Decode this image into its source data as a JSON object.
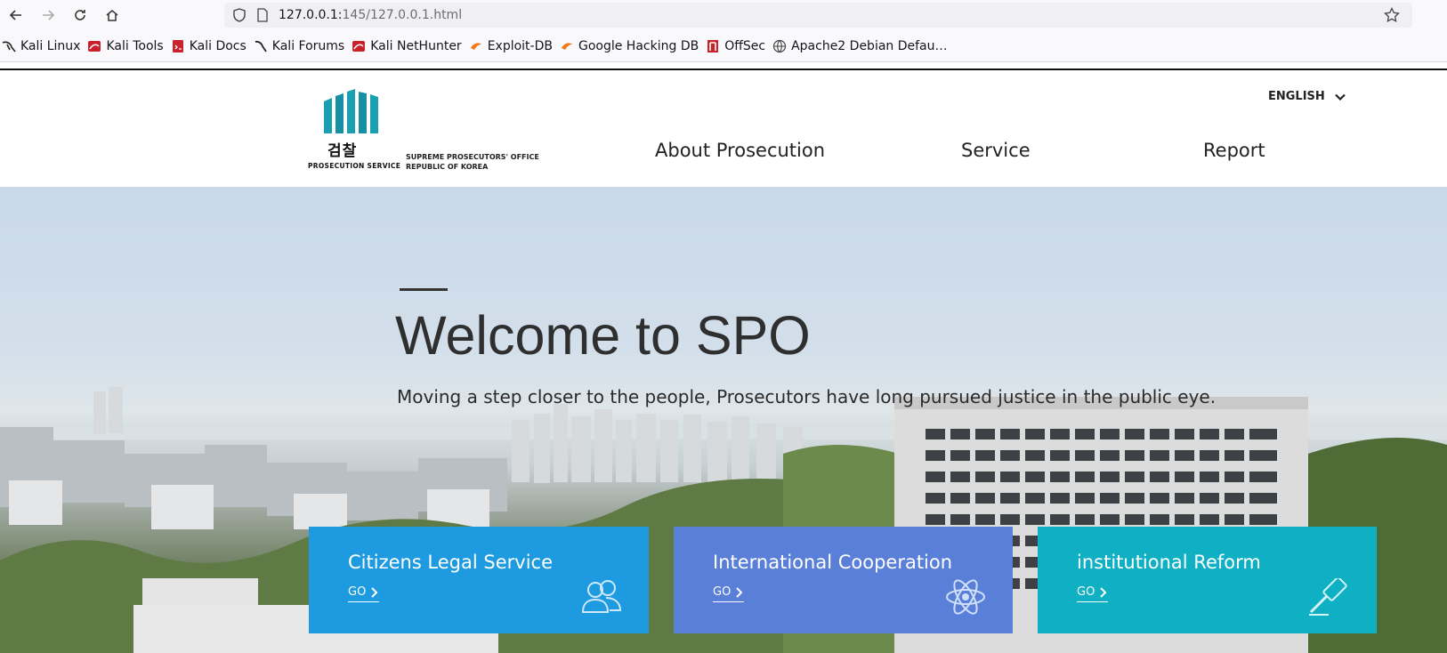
{
  "browser": {
    "url_host": "127.0.0.1:",
    "url_path": "145/127.0.0.1.html",
    "bookmarks": [
      {
        "label": "Kali Linux",
        "icon": "kali-dragon-icon"
      },
      {
        "label": "Kali Tools",
        "icon": "kali-tools-icon"
      },
      {
        "label": "Kali Docs",
        "icon": "kali-docs-icon"
      },
      {
        "label": "Kali Forums",
        "icon": "kali-forums-icon"
      },
      {
        "label": "Kali NetHunter",
        "icon": "kali-nethunter-icon"
      },
      {
        "label": "Exploit-DB",
        "icon": "exploit-db-icon"
      },
      {
        "label": "Google Hacking DB",
        "icon": "ghdb-icon"
      },
      {
        "label": "OffSec",
        "icon": "offsec-icon"
      },
      {
        "label": "Apache2 Debian Defau…",
        "icon": "globe-icon"
      }
    ]
  },
  "header": {
    "logo_hangul": "검찰",
    "logo_service": "PROSECUTION SERVICE",
    "office_line1": "SUPREME PROSECUTORS' OFFICE",
    "office_line2": "REPUBLIC OF KOREA",
    "language": "ENGLISH",
    "menu": [
      "About Prosecution",
      "Service",
      "Report"
    ]
  },
  "hero": {
    "title": "Welcome to SPO",
    "subtitle": "Moving a step closer to the people, Prosecutors have long pursued justice in the public eye."
  },
  "cards": [
    {
      "title": "Citizens Legal Service",
      "go": "GO",
      "color": "#1e9be0",
      "icon": "people-icon"
    },
    {
      "title": "International Cooperation",
      "go": "GO",
      "color": "#5a7fd8",
      "icon": "atom-icon"
    },
    {
      "title": "institutional Reform",
      "go": "GO",
      "color": "#0fb0c4",
      "icon": "gavel-icon"
    }
  ]
}
